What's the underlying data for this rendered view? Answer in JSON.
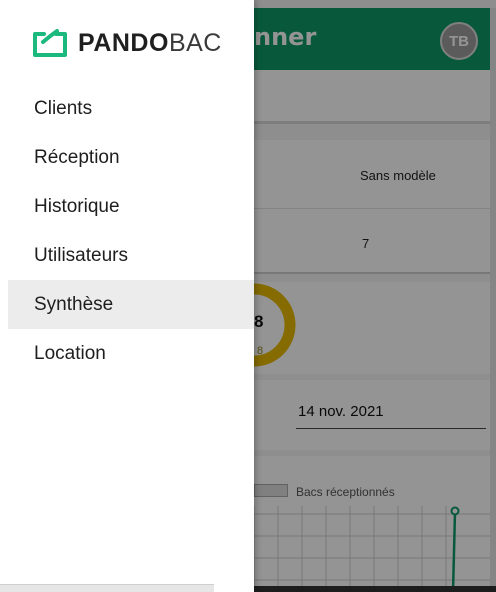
{
  "app": {
    "title_fragment": "nner",
    "user_initials": "TB",
    "table": {
      "header_label": "Sans modèle",
      "value": "7"
    },
    "donut": {
      "value": "8",
      "sub_value": "8",
      "color": "#e5b800"
    },
    "date": "14 nov. 2021",
    "chart": {
      "legend_label": "Bacs réceptionnés",
      "line_color": "#0f9a68"
    },
    "accent_color": "#0f9a68"
  },
  "drawer": {
    "brand_strong": "PANDO",
    "brand_light": "BAC",
    "brand_icon": "pandobac-crate-icon",
    "items": [
      {
        "label": "Clients",
        "active": false
      },
      {
        "label": "Réception",
        "active": false
      },
      {
        "label": "Historique",
        "active": false
      },
      {
        "label": "Utilisateurs",
        "active": false
      },
      {
        "label": "Synthèse",
        "active": true
      },
      {
        "label": "Location",
        "active": false
      }
    ]
  }
}
